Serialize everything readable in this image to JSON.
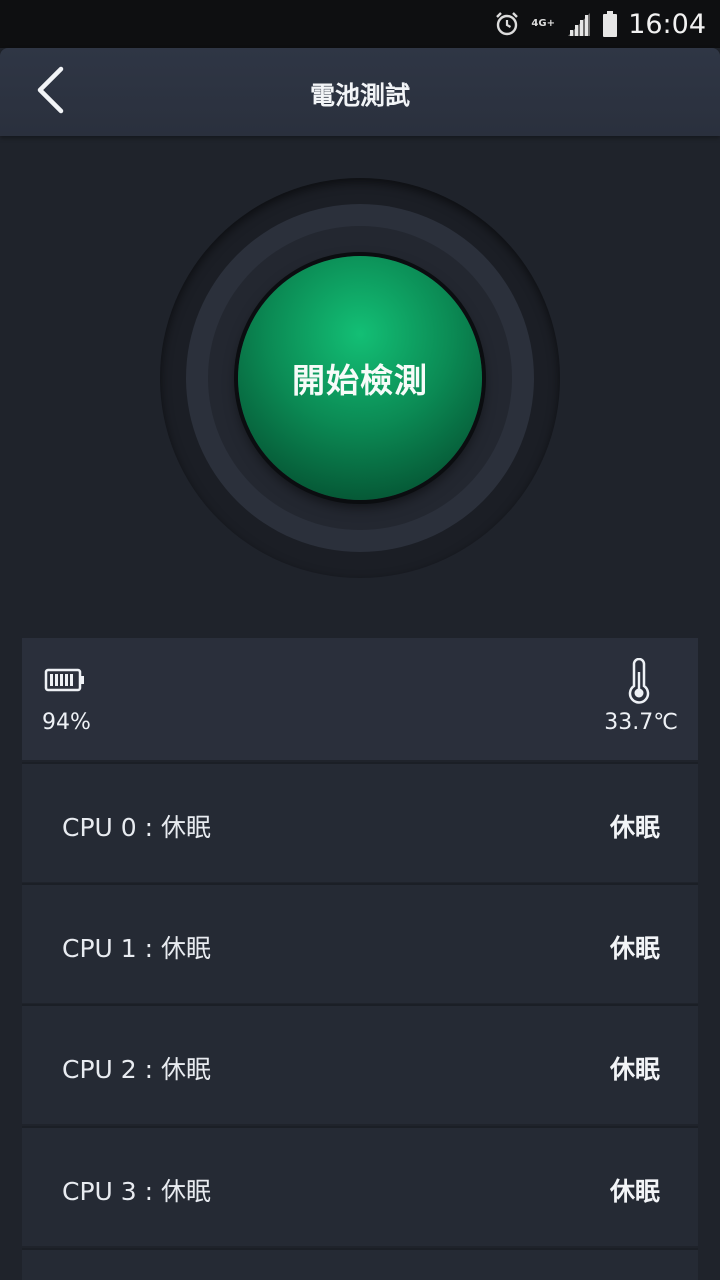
{
  "status_bar": {
    "network_label": "4G+",
    "time": "16:04",
    "icons": [
      "alarm-icon",
      "network-4g-icon",
      "signal-icon",
      "battery-icon"
    ]
  },
  "app_bar": {
    "title": "電池測試",
    "back_icon": "chevron-left-icon"
  },
  "start_button": {
    "label": "開始檢測"
  },
  "battery_info": {
    "battery_level": "94%",
    "temperature": "33.7℃"
  },
  "cpu_list": [
    {
      "label": "CPU  0 : 休眠",
      "state": "休眠"
    },
    {
      "label": "CPU  1 : 休眠",
      "state": "休眠"
    },
    {
      "label": "CPU  2 : 休眠",
      "state": "休眠"
    },
    {
      "label": "CPU  3 : 休眠",
      "state": "休眠"
    }
  ],
  "colors": {
    "background": "#1f232b",
    "card": "#2a2f3b",
    "accent_green": "#0b8a54"
  }
}
